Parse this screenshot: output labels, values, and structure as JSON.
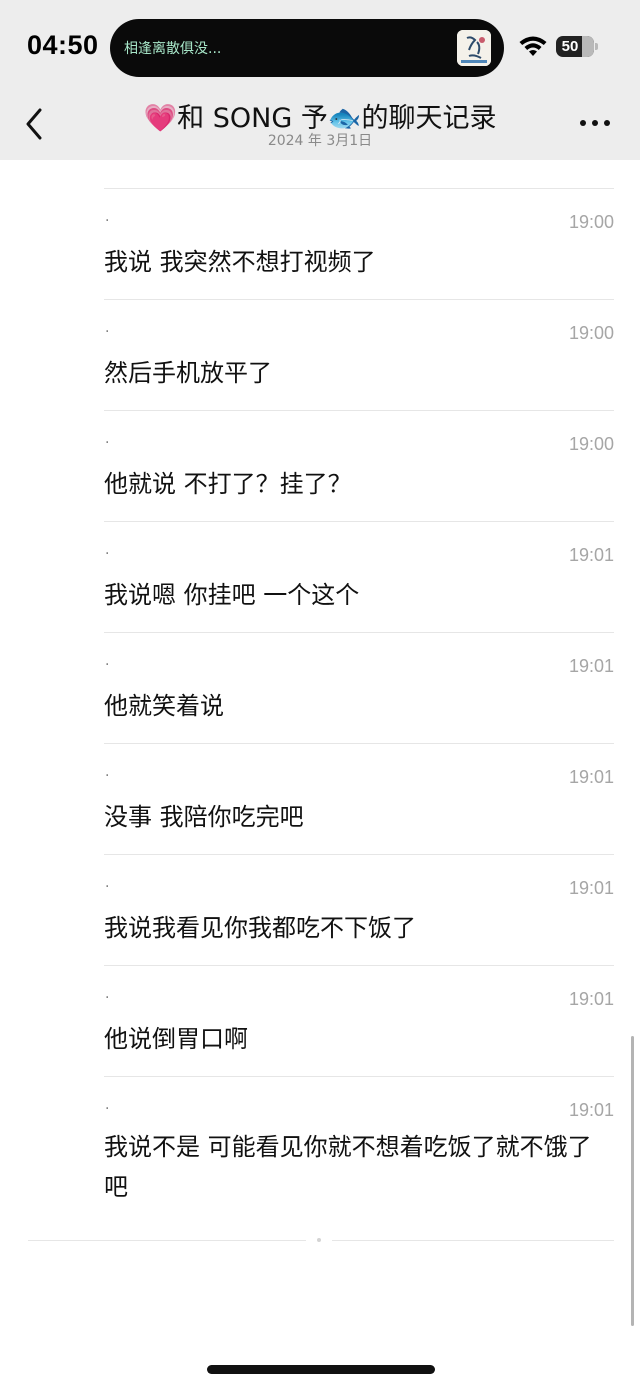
{
  "status_bar": {
    "time": "04:50",
    "now_playing": "相逢离散俱没...",
    "battery": "50",
    "battery_level_percent": 50
  },
  "nav": {
    "title": "💗和 SONG 予🐟的聊天记录",
    "subtitle": "2024 年 3月1日"
  },
  "messages": [
    {
      "sender": ".",
      "time": "19:00",
      "text": "我说 我突然不想打视频了"
    },
    {
      "sender": ".",
      "time": "19:00",
      "text": "然后手机放平了"
    },
    {
      "sender": ".",
      "time": "19:00",
      "text": "他就说  不打了？挂了？"
    },
    {
      "sender": ".",
      "time": "19:01",
      "text": "我说嗯 你挂吧 一个这个"
    },
    {
      "sender": ".",
      "time": "19:01",
      "text": "他就笑着说"
    },
    {
      "sender": ".",
      "time": "19:01",
      "text": "没事 我陪你吃完吧"
    },
    {
      "sender": ".",
      "time": "19:01",
      "text": "我说我看见你我都吃不下饭了"
    },
    {
      "sender": ".",
      "time": "19:01",
      "text": "他说倒胃口啊"
    },
    {
      "sender": ".",
      "time": "19:01",
      "text": "我说不是   可能看见你就不想着吃饭了就不饿了吧"
    }
  ]
}
